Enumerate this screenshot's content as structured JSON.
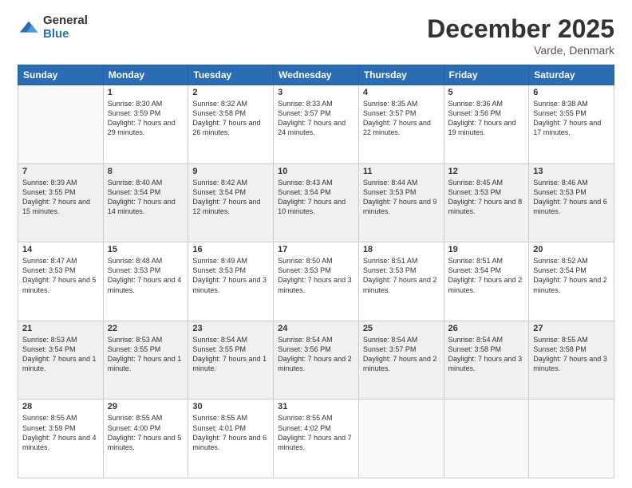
{
  "logo": {
    "general": "General",
    "blue": "Blue"
  },
  "title": "December 2025",
  "location": "Varde, Denmark",
  "weekdays": [
    "Sunday",
    "Monday",
    "Tuesday",
    "Wednesday",
    "Thursday",
    "Friday",
    "Saturday"
  ],
  "weeks": [
    [
      {
        "day": "",
        "sunrise": "",
        "sunset": "",
        "daylight": ""
      },
      {
        "day": "1",
        "sunrise": "Sunrise: 8:30 AM",
        "sunset": "Sunset: 3:59 PM",
        "daylight": "Daylight: 7 hours and 29 minutes."
      },
      {
        "day": "2",
        "sunrise": "Sunrise: 8:32 AM",
        "sunset": "Sunset: 3:58 PM",
        "daylight": "Daylight: 7 hours and 26 minutes."
      },
      {
        "day": "3",
        "sunrise": "Sunrise: 8:33 AM",
        "sunset": "Sunset: 3:57 PM",
        "daylight": "Daylight: 7 hours and 24 minutes."
      },
      {
        "day": "4",
        "sunrise": "Sunrise: 8:35 AM",
        "sunset": "Sunset: 3:57 PM",
        "daylight": "Daylight: 7 hours and 22 minutes."
      },
      {
        "day": "5",
        "sunrise": "Sunrise: 8:36 AM",
        "sunset": "Sunset: 3:56 PM",
        "daylight": "Daylight: 7 hours and 19 minutes."
      },
      {
        "day": "6",
        "sunrise": "Sunrise: 8:38 AM",
        "sunset": "Sunset: 3:55 PM",
        "daylight": "Daylight: 7 hours and 17 minutes."
      }
    ],
    [
      {
        "day": "7",
        "sunrise": "Sunrise: 8:39 AM",
        "sunset": "Sunset: 3:55 PM",
        "daylight": "Daylight: 7 hours and 15 minutes."
      },
      {
        "day": "8",
        "sunrise": "Sunrise: 8:40 AM",
        "sunset": "Sunset: 3:54 PM",
        "daylight": "Daylight: 7 hours and 14 minutes."
      },
      {
        "day": "9",
        "sunrise": "Sunrise: 8:42 AM",
        "sunset": "Sunset: 3:54 PM",
        "daylight": "Daylight: 7 hours and 12 minutes."
      },
      {
        "day": "10",
        "sunrise": "Sunrise: 8:43 AM",
        "sunset": "Sunset: 3:54 PM",
        "daylight": "Daylight: 7 hours and 10 minutes."
      },
      {
        "day": "11",
        "sunrise": "Sunrise: 8:44 AM",
        "sunset": "Sunset: 3:53 PM",
        "daylight": "Daylight: 7 hours and 9 minutes."
      },
      {
        "day": "12",
        "sunrise": "Sunrise: 8:45 AM",
        "sunset": "Sunset: 3:53 PM",
        "daylight": "Daylight: 7 hours and 8 minutes."
      },
      {
        "day": "13",
        "sunrise": "Sunrise: 8:46 AM",
        "sunset": "Sunset: 3:53 PM",
        "daylight": "Daylight: 7 hours and 6 minutes."
      }
    ],
    [
      {
        "day": "14",
        "sunrise": "Sunrise: 8:47 AM",
        "sunset": "Sunset: 3:53 PM",
        "daylight": "Daylight: 7 hours and 5 minutes."
      },
      {
        "day": "15",
        "sunrise": "Sunrise: 8:48 AM",
        "sunset": "Sunset: 3:53 PM",
        "daylight": "Daylight: 7 hours and 4 minutes."
      },
      {
        "day": "16",
        "sunrise": "Sunrise: 8:49 AM",
        "sunset": "Sunset: 3:53 PM",
        "daylight": "Daylight: 7 hours and 3 minutes."
      },
      {
        "day": "17",
        "sunrise": "Sunrise: 8:50 AM",
        "sunset": "Sunset: 3:53 PM",
        "daylight": "Daylight: 7 hours and 3 minutes."
      },
      {
        "day": "18",
        "sunrise": "Sunrise: 8:51 AM",
        "sunset": "Sunset: 3:53 PM",
        "daylight": "Daylight: 7 hours and 2 minutes."
      },
      {
        "day": "19",
        "sunrise": "Sunrise: 8:51 AM",
        "sunset": "Sunset: 3:54 PM",
        "daylight": "Daylight: 7 hours and 2 minutes."
      },
      {
        "day": "20",
        "sunrise": "Sunrise: 8:52 AM",
        "sunset": "Sunset: 3:54 PM",
        "daylight": "Daylight: 7 hours and 2 minutes."
      }
    ],
    [
      {
        "day": "21",
        "sunrise": "Sunrise: 8:53 AM",
        "sunset": "Sunset: 3:54 PM",
        "daylight": "Daylight: 7 hours and 1 minute."
      },
      {
        "day": "22",
        "sunrise": "Sunrise: 8:53 AM",
        "sunset": "Sunset: 3:55 PM",
        "daylight": "Daylight: 7 hours and 1 minute."
      },
      {
        "day": "23",
        "sunrise": "Sunrise: 8:54 AM",
        "sunset": "Sunset: 3:55 PM",
        "daylight": "Daylight: 7 hours and 1 minute."
      },
      {
        "day": "24",
        "sunrise": "Sunrise: 8:54 AM",
        "sunset": "Sunset: 3:56 PM",
        "daylight": "Daylight: 7 hours and 2 minutes."
      },
      {
        "day": "25",
        "sunrise": "Sunrise: 8:54 AM",
        "sunset": "Sunset: 3:57 PM",
        "daylight": "Daylight: 7 hours and 2 minutes."
      },
      {
        "day": "26",
        "sunrise": "Sunrise: 8:54 AM",
        "sunset": "Sunset: 3:58 PM",
        "daylight": "Daylight: 7 hours and 3 minutes."
      },
      {
        "day": "27",
        "sunrise": "Sunrise: 8:55 AM",
        "sunset": "Sunset: 3:58 PM",
        "daylight": "Daylight: 7 hours and 3 minutes."
      }
    ],
    [
      {
        "day": "28",
        "sunrise": "Sunrise: 8:55 AM",
        "sunset": "Sunset: 3:59 PM",
        "daylight": "Daylight: 7 hours and 4 minutes."
      },
      {
        "day": "29",
        "sunrise": "Sunrise: 8:55 AM",
        "sunset": "Sunset: 4:00 PM",
        "daylight": "Daylight: 7 hours and 5 minutes."
      },
      {
        "day": "30",
        "sunrise": "Sunrise: 8:55 AM",
        "sunset": "Sunset: 4:01 PM",
        "daylight": "Daylight: 7 hours and 6 minutes."
      },
      {
        "day": "31",
        "sunrise": "Sunrise: 8:55 AM",
        "sunset": "Sunset: 4:02 PM",
        "daylight": "Daylight: 7 hours and 7 minutes."
      },
      {
        "day": "",
        "sunrise": "",
        "sunset": "",
        "daylight": ""
      },
      {
        "day": "",
        "sunrise": "",
        "sunset": "",
        "daylight": ""
      },
      {
        "day": "",
        "sunrise": "",
        "sunset": "",
        "daylight": ""
      }
    ]
  ]
}
